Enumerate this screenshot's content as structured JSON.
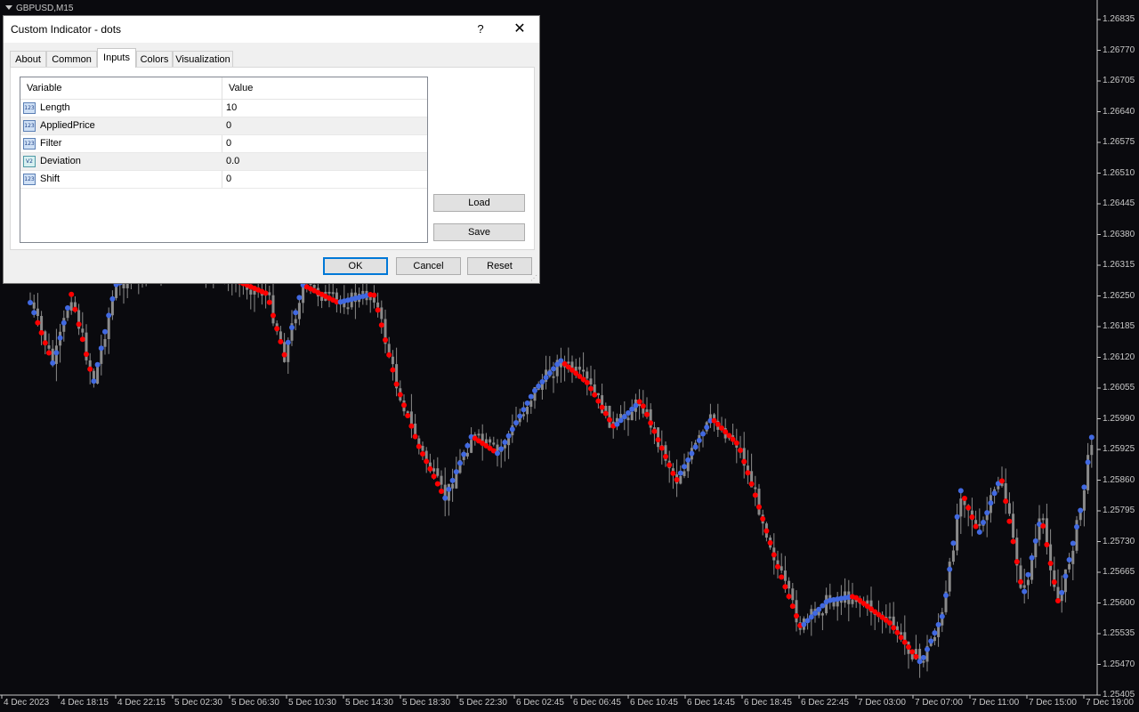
{
  "chart": {
    "symbol_label": "GBPUSD,M15",
    "price_labels": [
      "1.26835",
      "1.26770",
      "1.26705",
      "1.26640",
      "1.26575",
      "1.26510",
      "1.26445",
      "1.26380",
      "1.26315",
      "1.26250",
      "1.26185",
      "1.26120",
      "1.26055",
      "1.25990",
      "1.25925",
      "1.25860",
      "1.25795",
      "1.25730",
      "1.25665",
      "1.25600",
      "1.25535",
      "1.25470",
      "1.25405"
    ],
    "time_labels": [
      "4 Dec 2023",
      "4 Dec 18:15",
      "4 Dec 22:15",
      "5 Dec 02:30",
      "5 Dec 06:30",
      "5 Dec 10:30",
      "5 Dec 14:30",
      "5 Dec 18:30",
      "5 Dec 22:30",
      "6 Dec 02:45",
      "6 Dec 06:45",
      "6 Dec 10:45",
      "6 Dec 14:45",
      "6 Dec 18:45",
      "6 Dec 22:45",
      "7 Dec 03:00",
      "7 Dec 07:00",
      "7 Dec 11:00",
      "7 Dec 15:00",
      "7 Dec 19:00"
    ],
    "colors": {
      "background": "#0a0a0e",
      "candle": "#8a8a8a",
      "dot_up": "#4169e1",
      "dot_down": "#ff0000",
      "grid_text": "#c8c8c8"
    }
  },
  "dialog": {
    "title": "Custom Indicator - dots",
    "help_label": "?",
    "close_label": "✕",
    "tabs": [
      {
        "label": "About",
        "active": false
      },
      {
        "label": "Common",
        "active": false
      },
      {
        "label": "Inputs",
        "active": true
      },
      {
        "label": "Colors",
        "active": false
      },
      {
        "label": "Visualization",
        "active": false
      }
    ],
    "grid": {
      "headers": {
        "variable": "Variable",
        "value": "Value"
      },
      "rows": [
        {
          "icon": "int-icon",
          "icon_text": "123",
          "name": "Length",
          "value": "10"
        },
        {
          "icon": "int-icon",
          "icon_text": "123",
          "name": "AppliedPrice",
          "value": "0"
        },
        {
          "icon": "int-icon",
          "icon_text": "123",
          "name": "Filter",
          "value": "0"
        },
        {
          "icon": "double-icon",
          "icon_text": "V2",
          "name": "Deviation",
          "value": "0.0"
        },
        {
          "icon": "int-icon",
          "icon_text": "123",
          "name": "Shift",
          "value": "0"
        }
      ]
    },
    "buttons": {
      "load": "Load",
      "save": "Save",
      "ok": "OK",
      "cancel": "Cancel",
      "reset": "Reset"
    }
  }
}
